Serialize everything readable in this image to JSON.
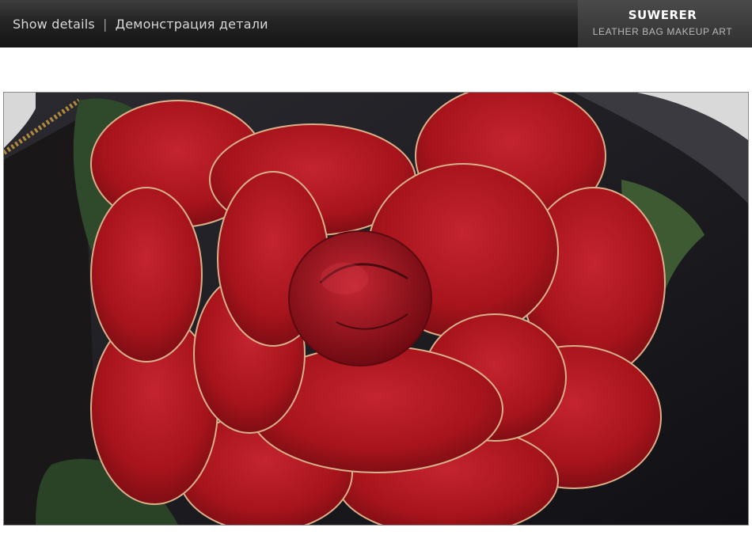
{
  "banner": {
    "left_label": "Show details",
    "separator": "|",
    "right_label": "Демонстрация детали"
  },
  "brand": {
    "name": "SUWERER",
    "tagline": "LEATHER BAG MAKEUP ART"
  },
  "photo": {
    "subject": "close-up-photo",
    "colors": {
      "petal": "#a8141c",
      "petal_dark": "#6a0a10",
      "petal_edge": "#d9b08a",
      "leaf": "#2f4a2a",
      "leather_black": "#1c1c22"
    }
  }
}
